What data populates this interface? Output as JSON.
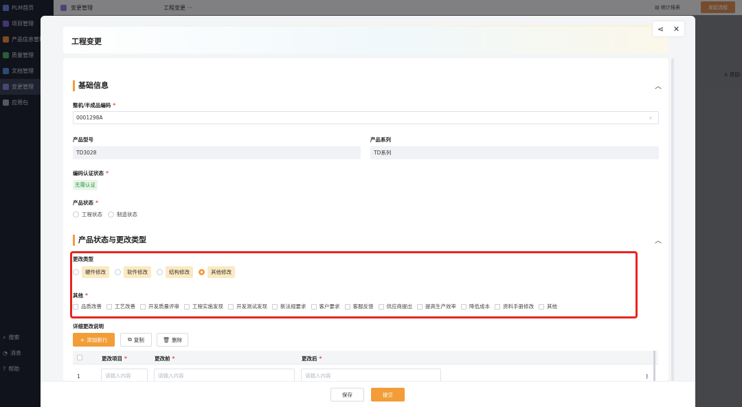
{
  "sidebar": {
    "items": [
      {
        "label": "PLM首页",
        "color": "#6b7fd6"
      },
      {
        "label": "项目管理",
        "color": "#7a5fd0"
      },
      {
        "label": "产品信息管理",
        "color": "#e08b3a"
      },
      {
        "label": "质量管理",
        "color": "#4fa86a"
      },
      {
        "label": "文档管理",
        "color": "#4b8ad8"
      },
      {
        "label": "变更管理",
        "color": "#8f7ad6"
      },
      {
        "label": "应用包",
        "color": "#9aa0ad"
      }
    ],
    "bottom": [
      {
        "label": "搜索"
      },
      {
        "label": "消息"
      },
      {
        "label": "帮助"
      }
    ]
  },
  "topbar": {
    "tab_label": "变更管理",
    "page_label": "工程变更",
    "more": "···",
    "stats_label": "统计报表",
    "launch_label": "发起流程"
  },
  "bg": {
    "column_label": "项目I"
  },
  "modal": {
    "title": "工程变更",
    "share_icon": "share-icon",
    "close_icon": "close-icon",
    "basic": {
      "title": "基础信息",
      "code_label": "整机/半成品编码",
      "code_value": "0001298A",
      "model_label": "产品型号",
      "model_value": "TD3028",
      "series_label": "产品系列",
      "series_value": "TD系列",
      "cert_label": "编码认证状态",
      "cert_value": "无需认证",
      "status_label": "产品状态",
      "status_options": [
        "工程状态",
        "制造状态"
      ]
    },
    "change": {
      "title": "产品状态与更改类型",
      "type_label": "更改类型",
      "type_options": [
        "硬件修改",
        "软件修改",
        "结构修改",
        "其他修改"
      ],
      "type_selected": "其他修改",
      "other_label": "其他",
      "other_options": [
        "品质改善",
        "工艺改善",
        "开发质量评审",
        "工程实施发现",
        "开发测试发现",
        "新法规要求",
        "客户要求",
        "客服反馈",
        "供应商提出",
        "提高生产效率",
        "降低成本",
        "资料手册修改",
        "其他"
      ]
    },
    "detail": {
      "title": "详细更改说明",
      "add_label": "添加新行",
      "copy_label": "复制",
      "delete_label": "删除",
      "headers": [
        "更改项目",
        "更改前",
        "更改后"
      ],
      "rows": [
        {
          "index": "1",
          "placeholder_item": "请输入内容",
          "placeholder_before": "请输入内容",
          "placeholder_after": "请输入内容"
        }
      ]
    },
    "footer": {
      "save_label": "保存",
      "submit_label": "提交"
    }
  },
  "colors": {
    "accent": "#f29d38",
    "highlight_border": "#e8231b",
    "required": "#e64a3b"
  }
}
